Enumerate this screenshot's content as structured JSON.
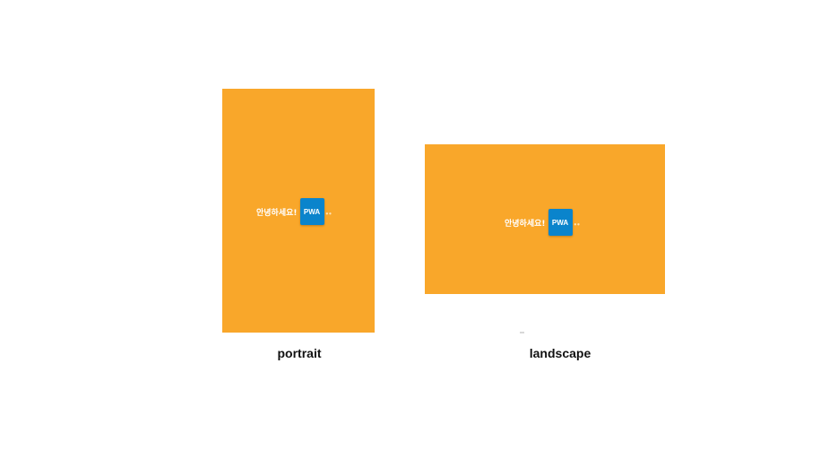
{
  "colors": {
    "screen_background": "#F9A72A",
    "badge_background": "#0A84CC"
  },
  "portrait": {
    "greeting": "안녕하세요!",
    "badge": "PWA",
    "caption": "portrait"
  },
  "landscape": {
    "greeting": "안녕하세요!",
    "badge": "PWA",
    "caption": "landscape"
  }
}
